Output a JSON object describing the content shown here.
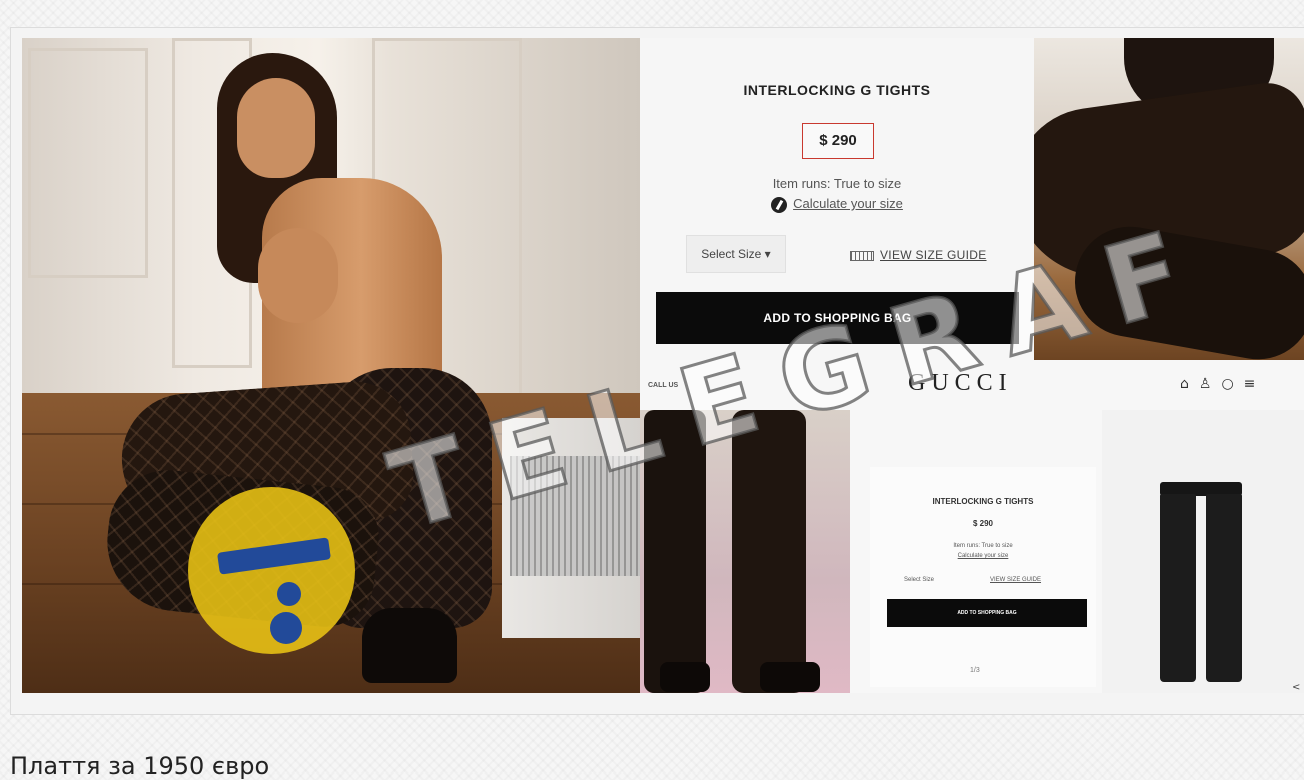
{
  "product_card": {
    "title": "INTERLOCKING G TIGHTS",
    "price": "$ 290",
    "item_runs": "Item runs: True to size",
    "calculate_link": "Calculate your size",
    "select_size": "Select Size",
    "size_guide": "VIEW SIZE GUIDE",
    "add_to_bag": "ADD TO SHOPPING BAG"
  },
  "gucci_page": {
    "nav_left": "CALL US",
    "logo": "GUCCI",
    "icons": [
      "bag-icon",
      "account-icon",
      "search-icon",
      "menu-icon"
    ],
    "mini_card": {
      "title": "INTERLOCKING G TIGHTS",
      "price": "$ 290",
      "item_runs": "Item runs: True to size",
      "calculate_link": "Calculate your size",
      "select_size": "Select Size",
      "size_guide": "VIEW SIZE GUIDE",
      "add_to_bag": "ADD TO SHOPPING BAG",
      "pager": "1/3"
    }
  },
  "watermark": {
    "text": "TELEGRAF",
    "logo_color": "#EBC414",
    "logo_accent": "#1844A0"
  },
  "caption": "Плаття за 1950 євро"
}
